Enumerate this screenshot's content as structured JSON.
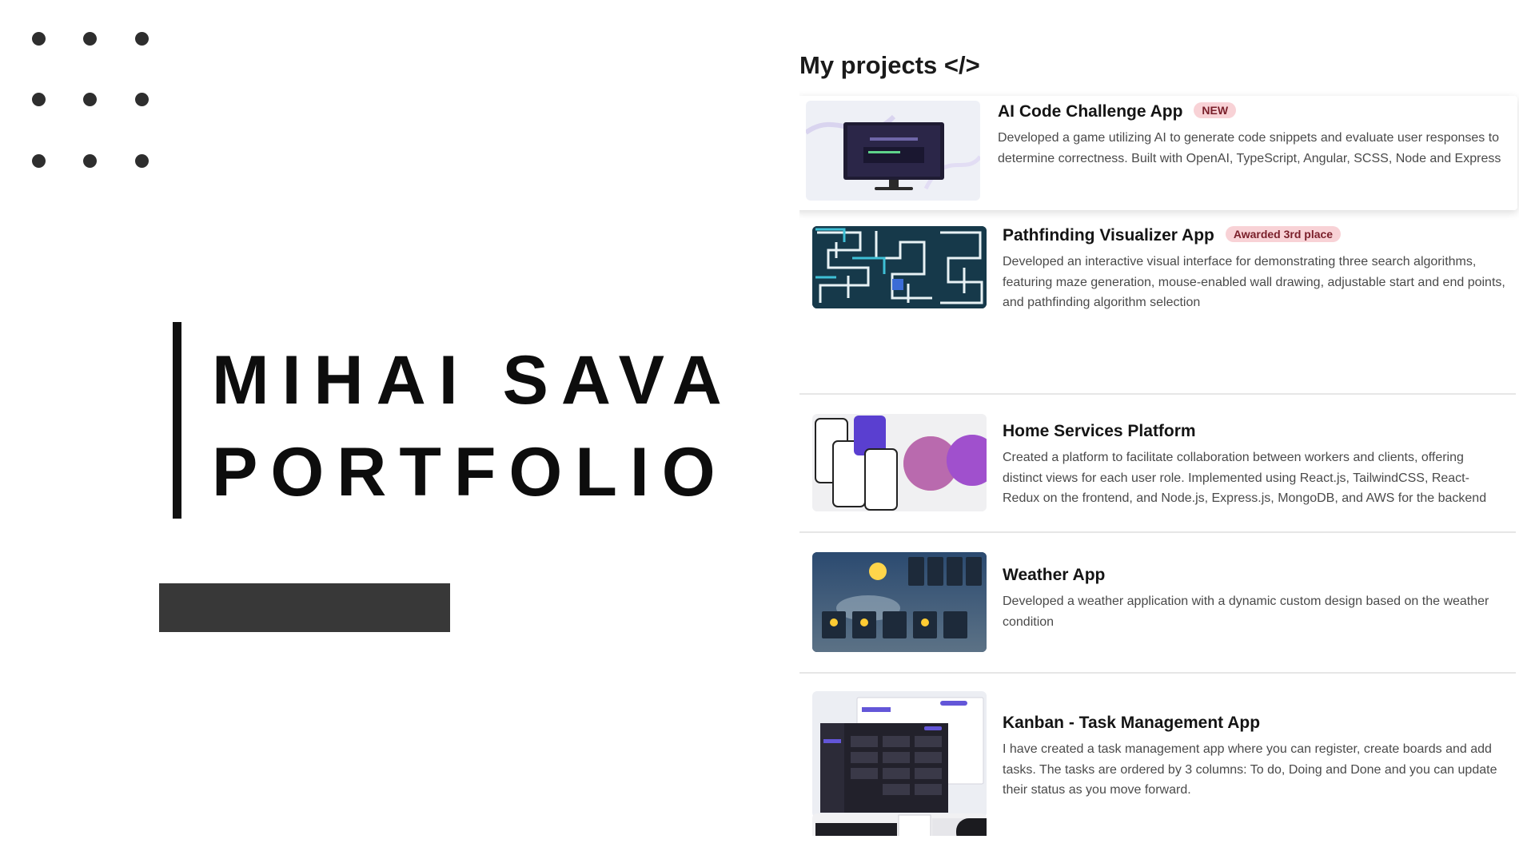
{
  "portfolio": {
    "title_line1": "MIHAI SAVA",
    "title_line2": "PORTFOLIO"
  },
  "projects_section": {
    "heading": "My projects </>",
    "items": [
      {
        "title": "AI Code Challenge App",
        "badge": "NEW",
        "description": "Developed a game utilizing AI to generate code snippets and evaluate user responses to determine correctness. Built with OpenAI, TypeScript, Angular, SCSS, Node and Express",
        "thumbnail_icon": "monitor-screenshot-icon"
      },
      {
        "title": "Pathfinding Visualizer App",
        "badge": "Awarded 3rd place",
        "description": "Developed an interactive visual interface for demonstrating three search algorithms, featuring maze generation, mouse-enabled wall drawing, adjustable start and end points, and pathfinding algorithm selection",
        "thumbnail_icon": "maze-screenshot-icon"
      },
      {
        "title": "Home Services Platform",
        "badge": "",
        "description": "Created a platform to facilitate collaboration between workers and clients, offering distinct views for each user role. Implemented using React.js, TailwindCSS, React-Redux on the frontend, and Node.js, Express.js, MongoDB, and AWS for the backend",
        "thumbnail_icon": "phones-screenshot-icon"
      },
      {
        "title": "Weather App",
        "badge": "",
        "description": "Developed a weather application with a dynamic custom design based on the weather condition",
        "thumbnail_icon": "weather-screenshot-icon"
      },
      {
        "title": "Kanban - Task Management App",
        "badge": "",
        "description": "I have created a task management app where you can register, create boards and add tasks. The tasks are ordered by 3 columns: To do, Doing and Done and you can update their status as you move forward.",
        "thumbnail_icon": "kanban-screenshot-icon"
      }
    ]
  },
  "colors": {
    "background": "#ffffff",
    "title_text": "#0d0d0d",
    "badge_bg": "#f8d2d6",
    "badge_text": "#7a1f2a",
    "dark_block": "#383838"
  }
}
